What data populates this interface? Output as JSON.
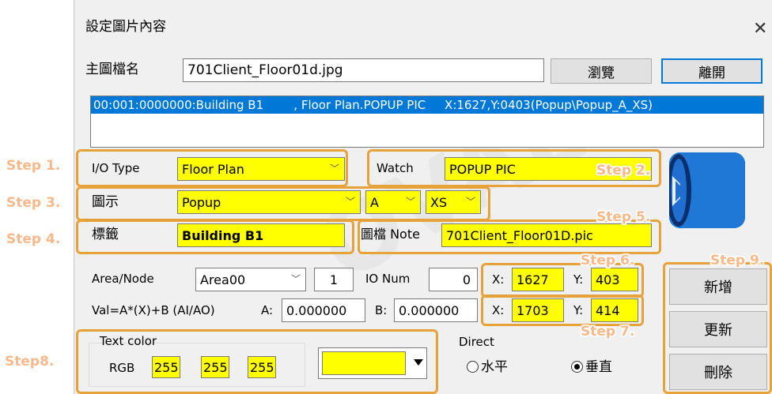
{
  "dialog": {
    "title": "設定圖片內容",
    "close_glyph": "✕"
  },
  "main_file": {
    "label": "主圖檔名",
    "value": "701Client_Floor01d.jpg",
    "browse_button": "瀏覽",
    "leave_button": "離開"
  },
  "list": {
    "selected_item": "00:001:0000000:Building B1        , Floor Plan.POPUP PIC     X:1627,Y:0403(Popup\\Popup_A_XS)"
  },
  "io_type": {
    "label": "I/O Type",
    "value": "Floor Plan"
  },
  "watch": {
    "label": "Watch",
    "value": "POPUP PIC"
  },
  "icon_display": {
    "label": "圖示",
    "value": "Popup",
    "variant": "A",
    "size": "XS"
  },
  "tag": {
    "label": "標籤",
    "value": "Building B1"
  },
  "image_note": {
    "label": "圖檔 Note",
    "value": "701Client_Floor01D.pic"
  },
  "area_node": {
    "label": "Area/Node",
    "area_value": "Area00",
    "node_value": "1"
  },
  "io_num": {
    "label": "IO Num",
    "value": "0"
  },
  "pos1": {
    "x_label": "X:",
    "x_value": "1627",
    "y_label": "Y:",
    "y_value": "403"
  },
  "pos2": {
    "x_label": "X:",
    "x_value": "1703",
    "y_label": "Y:",
    "y_value": "414"
  },
  "formula": {
    "label": "Val=A*(X)+B (AI/AO)",
    "a_label": "A:",
    "a_value": "0.000000",
    "b_label": "B:",
    "b_value": "0.000000"
  },
  "text_color": {
    "group_label": "Text color",
    "rgb_label": "RGB",
    "r": "255",
    "g": "255",
    "b": "255",
    "swatch_color": "#ffff00"
  },
  "direct": {
    "label": "Direct",
    "option_horizontal": "水平",
    "option_vertical": "垂直",
    "selected": "垂直"
  },
  "actions": {
    "add": "新增",
    "update": "更新",
    "delete": "刪除"
  },
  "steps": {
    "s1": "Step 1.",
    "s2": "Step 2.",
    "s3": "Step 3.",
    "s4": "Step 4.",
    "s5": "Step 5.",
    "s6": "Step 6.",
    "s7": "Step 7.",
    "s8": "Step8.",
    "s9": "Step 9."
  },
  "colors": {
    "highlight": "#ffeb00",
    "highlight_border": "#e8a23a",
    "step_text": "#f7b88a",
    "list_selection": "#0078d7",
    "icon_blue": "#1a6fd0"
  },
  "icon_preview": {
    "name": "shield-icon"
  }
}
